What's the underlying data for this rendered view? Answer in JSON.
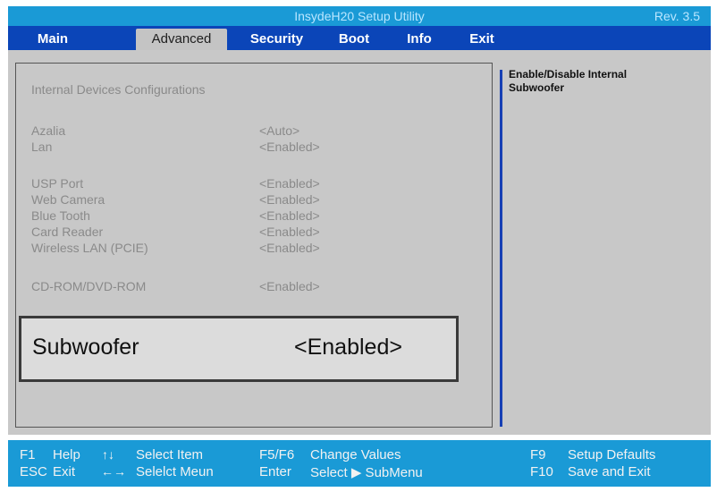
{
  "window": {
    "title": "InsydeH20 Setup Utility",
    "revision": "Rev. 3.5"
  },
  "menu": [
    {
      "label": "Main",
      "active": false
    },
    {
      "label": "Advanced",
      "active": true
    },
    {
      "label": "Security",
      "active": false
    },
    {
      "label": "Boot",
      "active": false
    },
    {
      "label": "Info",
      "active": false
    },
    {
      "label": "Exit",
      "active": false
    }
  ],
  "main": {
    "section_title": "Internal Devices Configurations",
    "items": [
      {
        "label": "Azalia",
        "value": "<Auto>"
      },
      {
        "label": "Lan",
        "value": "<Enabled>"
      },
      {
        "label": "USP Port",
        "value": "<Enabled>"
      },
      {
        "label": "Web Camera",
        "value": "<Enabled>"
      },
      {
        "label": "Blue Tooth",
        "value": "<Enabled>"
      },
      {
        "label": "Card Reader",
        "value": "<Enabled>"
      },
      {
        "label": "Wireless LAN (PCIE)",
        "value": "<Enabled>"
      },
      {
        "label": "CD-ROM/DVD-ROM",
        "value": "<Enabled>"
      }
    ],
    "selected": {
      "label": "Subwoofer",
      "value": "<Enabled>"
    }
  },
  "help": {
    "text_line1": "Enable/Disable Internal",
    "text_line2": "Subwoofer"
  },
  "footer": {
    "f1_key": "F1",
    "f1_label": "Help",
    "esc_key": "ESC",
    "esc_label": "Exit",
    "updown_arrow": "↑↓",
    "updown_label": "Select Item",
    "leftright_arrow": "←→",
    "leftright_label": "Selelct Meun",
    "f5f6_key": "F5/F6",
    "f5f6_label": "Change Values",
    "enter_key": "Enter",
    "enter_label": "Select ▶ SubMenu",
    "f9_key": "F9",
    "f9_label": "Setup Defaults",
    "f10_key": "F10",
    "f10_label": "Save and Exit"
  },
  "colors": {
    "title_bar": "#1a9ad6",
    "menu_bar": "#0b45b8",
    "panel": "#c8c8c8",
    "help_divider": "#1740b4",
    "footer": "#1a9ad6"
  }
}
